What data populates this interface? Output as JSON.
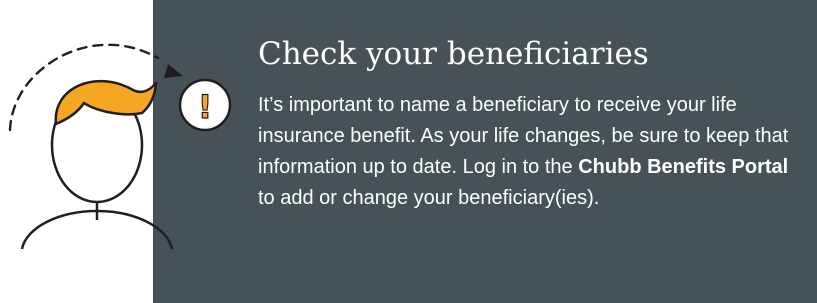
{
  "callout": {
    "title": "Check your beneficiaries",
    "body_before_link": "It’s important to name a beneficiary to receive your life insurance benefit. As your life changes, be sure to keep that information up to date. Log in to the ",
    "link_text": "Chubb Benefits Portal",
    "body_after_link": " to add or change your beneficiary(ies)."
  },
  "illustration": {
    "alert_symbol": "!",
    "icon_names": [
      "person-icon",
      "alert-icon",
      "dashed-arrow-icon"
    ]
  },
  "colors": {
    "panel_background": "#475158",
    "accent": "#f5a623",
    "text": "#ffffff",
    "outline": "#1f1f1f"
  }
}
